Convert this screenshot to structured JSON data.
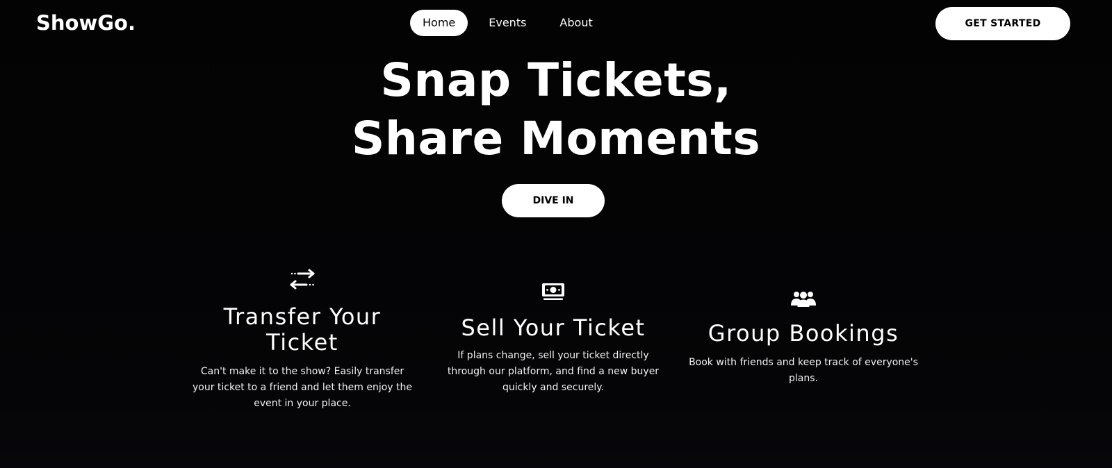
{
  "header": {
    "logo": "ShowGo.",
    "nav": [
      {
        "label": "Home",
        "active": true
      },
      {
        "label": "Events",
        "active": false
      },
      {
        "label": "About",
        "active": false
      }
    ],
    "cta_label": "GET STARTED"
  },
  "hero": {
    "line1": "Snap Tickets,",
    "line2": "Share Moments",
    "button_label": "DIVE IN"
  },
  "features": [
    {
      "icon": "transfer-arrows-icon",
      "title": "Transfer Your Ticket",
      "description": "Can't make it to the show? Easily transfer your ticket to a friend and let them enjoy the event in your place."
    },
    {
      "icon": "money-bill-icon",
      "title": "Sell Your Ticket",
      "description": "If plans change, sell your ticket directly through our platform, and find a new buyer quickly and securely."
    },
    {
      "icon": "user-group-icon",
      "title": "Group Bookings",
      "description": "Book with friends and keep track of everyone's plans."
    }
  ],
  "colors": {
    "background": "#040404",
    "text": "#ffffff",
    "button_bg": "#ffffff",
    "button_text": "#000000"
  }
}
